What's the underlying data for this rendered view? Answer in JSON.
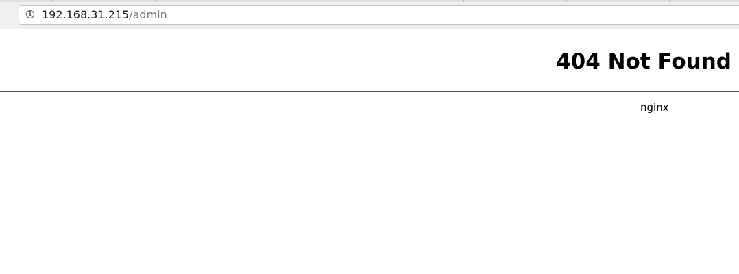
{
  "browser": {
    "address_bar": {
      "host": "192.168.31.215",
      "path": "/admin",
      "info_icon": "info-icon"
    }
  },
  "page": {
    "title": "404 Not Found",
    "server": "nginx"
  }
}
